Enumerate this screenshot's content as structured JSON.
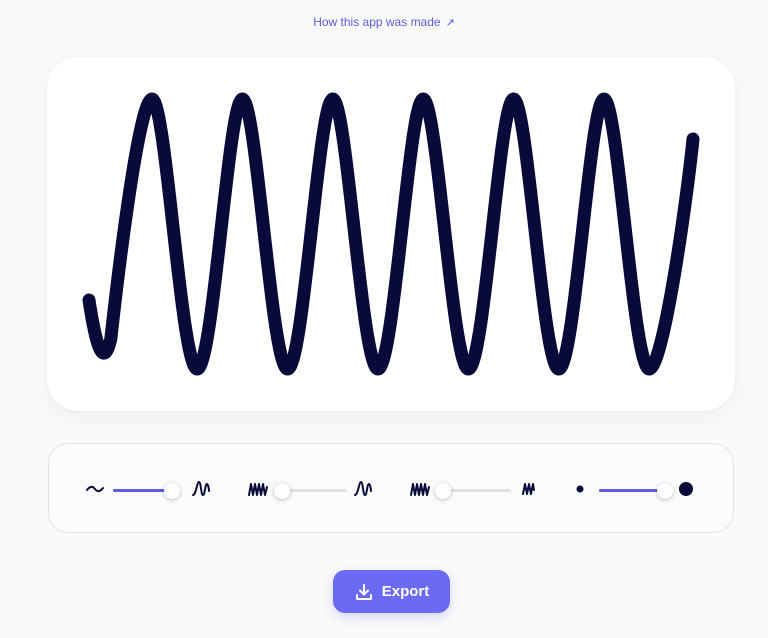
{
  "header": {
    "link_label": "How this app was made",
    "link_icon": "arrow-up-right-icon",
    "link_arrow": "↗"
  },
  "wave": {
    "color": "#0a0a3a",
    "peaks": 6
  },
  "controls": [
    {
      "name": "amplitude",
      "left_icon": "flat-wave-icon",
      "right_icon": "tall-wave-icon",
      "value": 0.92
    },
    {
      "name": "frequency",
      "left_icon": "dense-wave-icon",
      "right_icon": "sparse-wave-icon",
      "value": 0.1
    },
    {
      "name": "compression",
      "left_icon": "dense-wave-icon",
      "right_icon": "narrow-wave-icon",
      "value": 0.05
    },
    {
      "name": "thickness",
      "left_icon": "small-dot-icon",
      "right_icon": "large-dot-icon",
      "value": 0.92
    }
  ],
  "accent_color": "#5c5ce6",
  "export": {
    "label": "Export",
    "icon": "download-icon"
  }
}
